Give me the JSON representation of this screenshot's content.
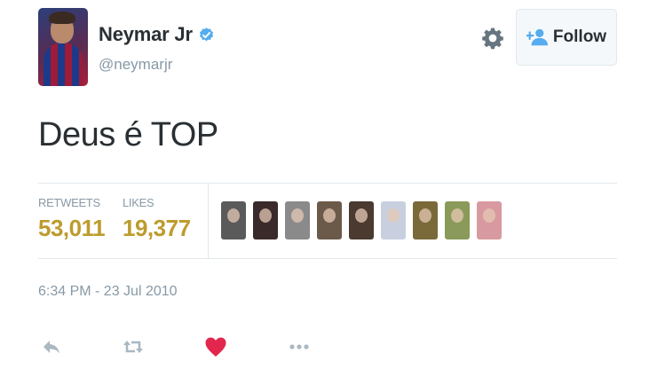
{
  "tweet": {
    "author": {
      "display_name": "Neymar Jr",
      "handle": "@neymarjr",
      "verified": true,
      "avatar_icon": "profile-photo"
    },
    "follow_button": {
      "label": "Follow",
      "icon": "add-user-icon"
    },
    "settings_icon": "gear-icon",
    "text": "Deus é TOP",
    "stats": {
      "retweets_label": "RETWEETS",
      "retweets_value": "53,011",
      "likes_label": "LIKES",
      "likes_value": "19,377"
    },
    "liker_avatars": [
      {
        "color": "#5a5a5a"
      },
      {
        "color": "#3a2a2a"
      },
      {
        "color": "#8a8a8a"
      },
      {
        "color": "#6b5a4a"
      },
      {
        "color": "#4a3a30"
      },
      {
        "color": "#c8d0e0"
      },
      {
        "color": "#7a6a3a"
      },
      {
        "color": "#8a9a5a"
      },
      {
        "color": "#d89aa0"
      }
    ],
    "timestamp": "6:34 PM - 23 Jul 2010",
    "actions": [
      {
        "name": "reply-icon"
      },
      {
        "name": "retweet-icon"
      },
      {
        "name": "like-icon"
      },
      {
        "name": "more-icon"
      }
    ],
    "colors": {
      "accent_blue": "#55acee",
      "stat_gold": "#bd9b2e",
      "like_red": "#e2264d",
      "muted_gray": "#8899a6"
    }
  }
}
